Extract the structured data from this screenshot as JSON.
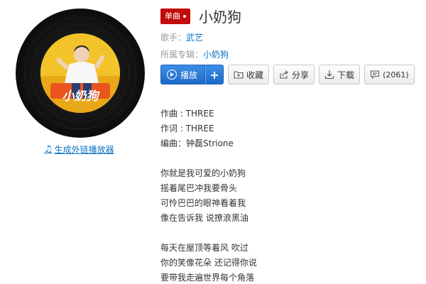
{
  "badge": {
    "label": "单曲"
  },
  "song": {
    "title": "小奶狗"
  },
  "meta": {
    "singer_label": "歌手：",
    "singer": "武艺",
    "album_label": "所属专辑：",
    "album": "小奶狗"
  },
  "cover": {
    "text": "小奶狗"
  },
  "actions": {
    "play": "播放",
    "add": "+",
    "collect": "收藏",
    "share": "分享",
    "download": "下载",
    "comments": "(2061)"
  },
  "ext_player": {
    "label": "生成外链播放器"
  },
  "credits": [
    "作曲 : THREE",
    "作词 : THREE",
    "编曲：钟磊Strione"
  ],
  "lyrics_block1": [
    "你就是我可爱的小奶狗",
    "摇着尾巴冲我要骨头",
    "可怜巴巴的眼神看着我",
    "像在告诉我 说撩浪黑油"
  ],
  "lyrics_block2": [
    "每天在屋顶等着风 吹过",
    "你的笑像花朵 还记得你说",
    "要带我走遍世界每个角落"
  ],
  "colors": {
    "accent_red": "#c20c0c",
    "link_blue": "#0c73c2",
    "play_blue": "#2a7ed8",
    "cover_yellow": "#f3c32a"
  },
  "icons": {
    "play": "play-circle-icon",
    "collect": "folder-plus-icon",
    "share": "share-icon",
    "download": "download-icon",
    "comment": "comment-icon",
    "note": "music-note-icon"
  }
}
